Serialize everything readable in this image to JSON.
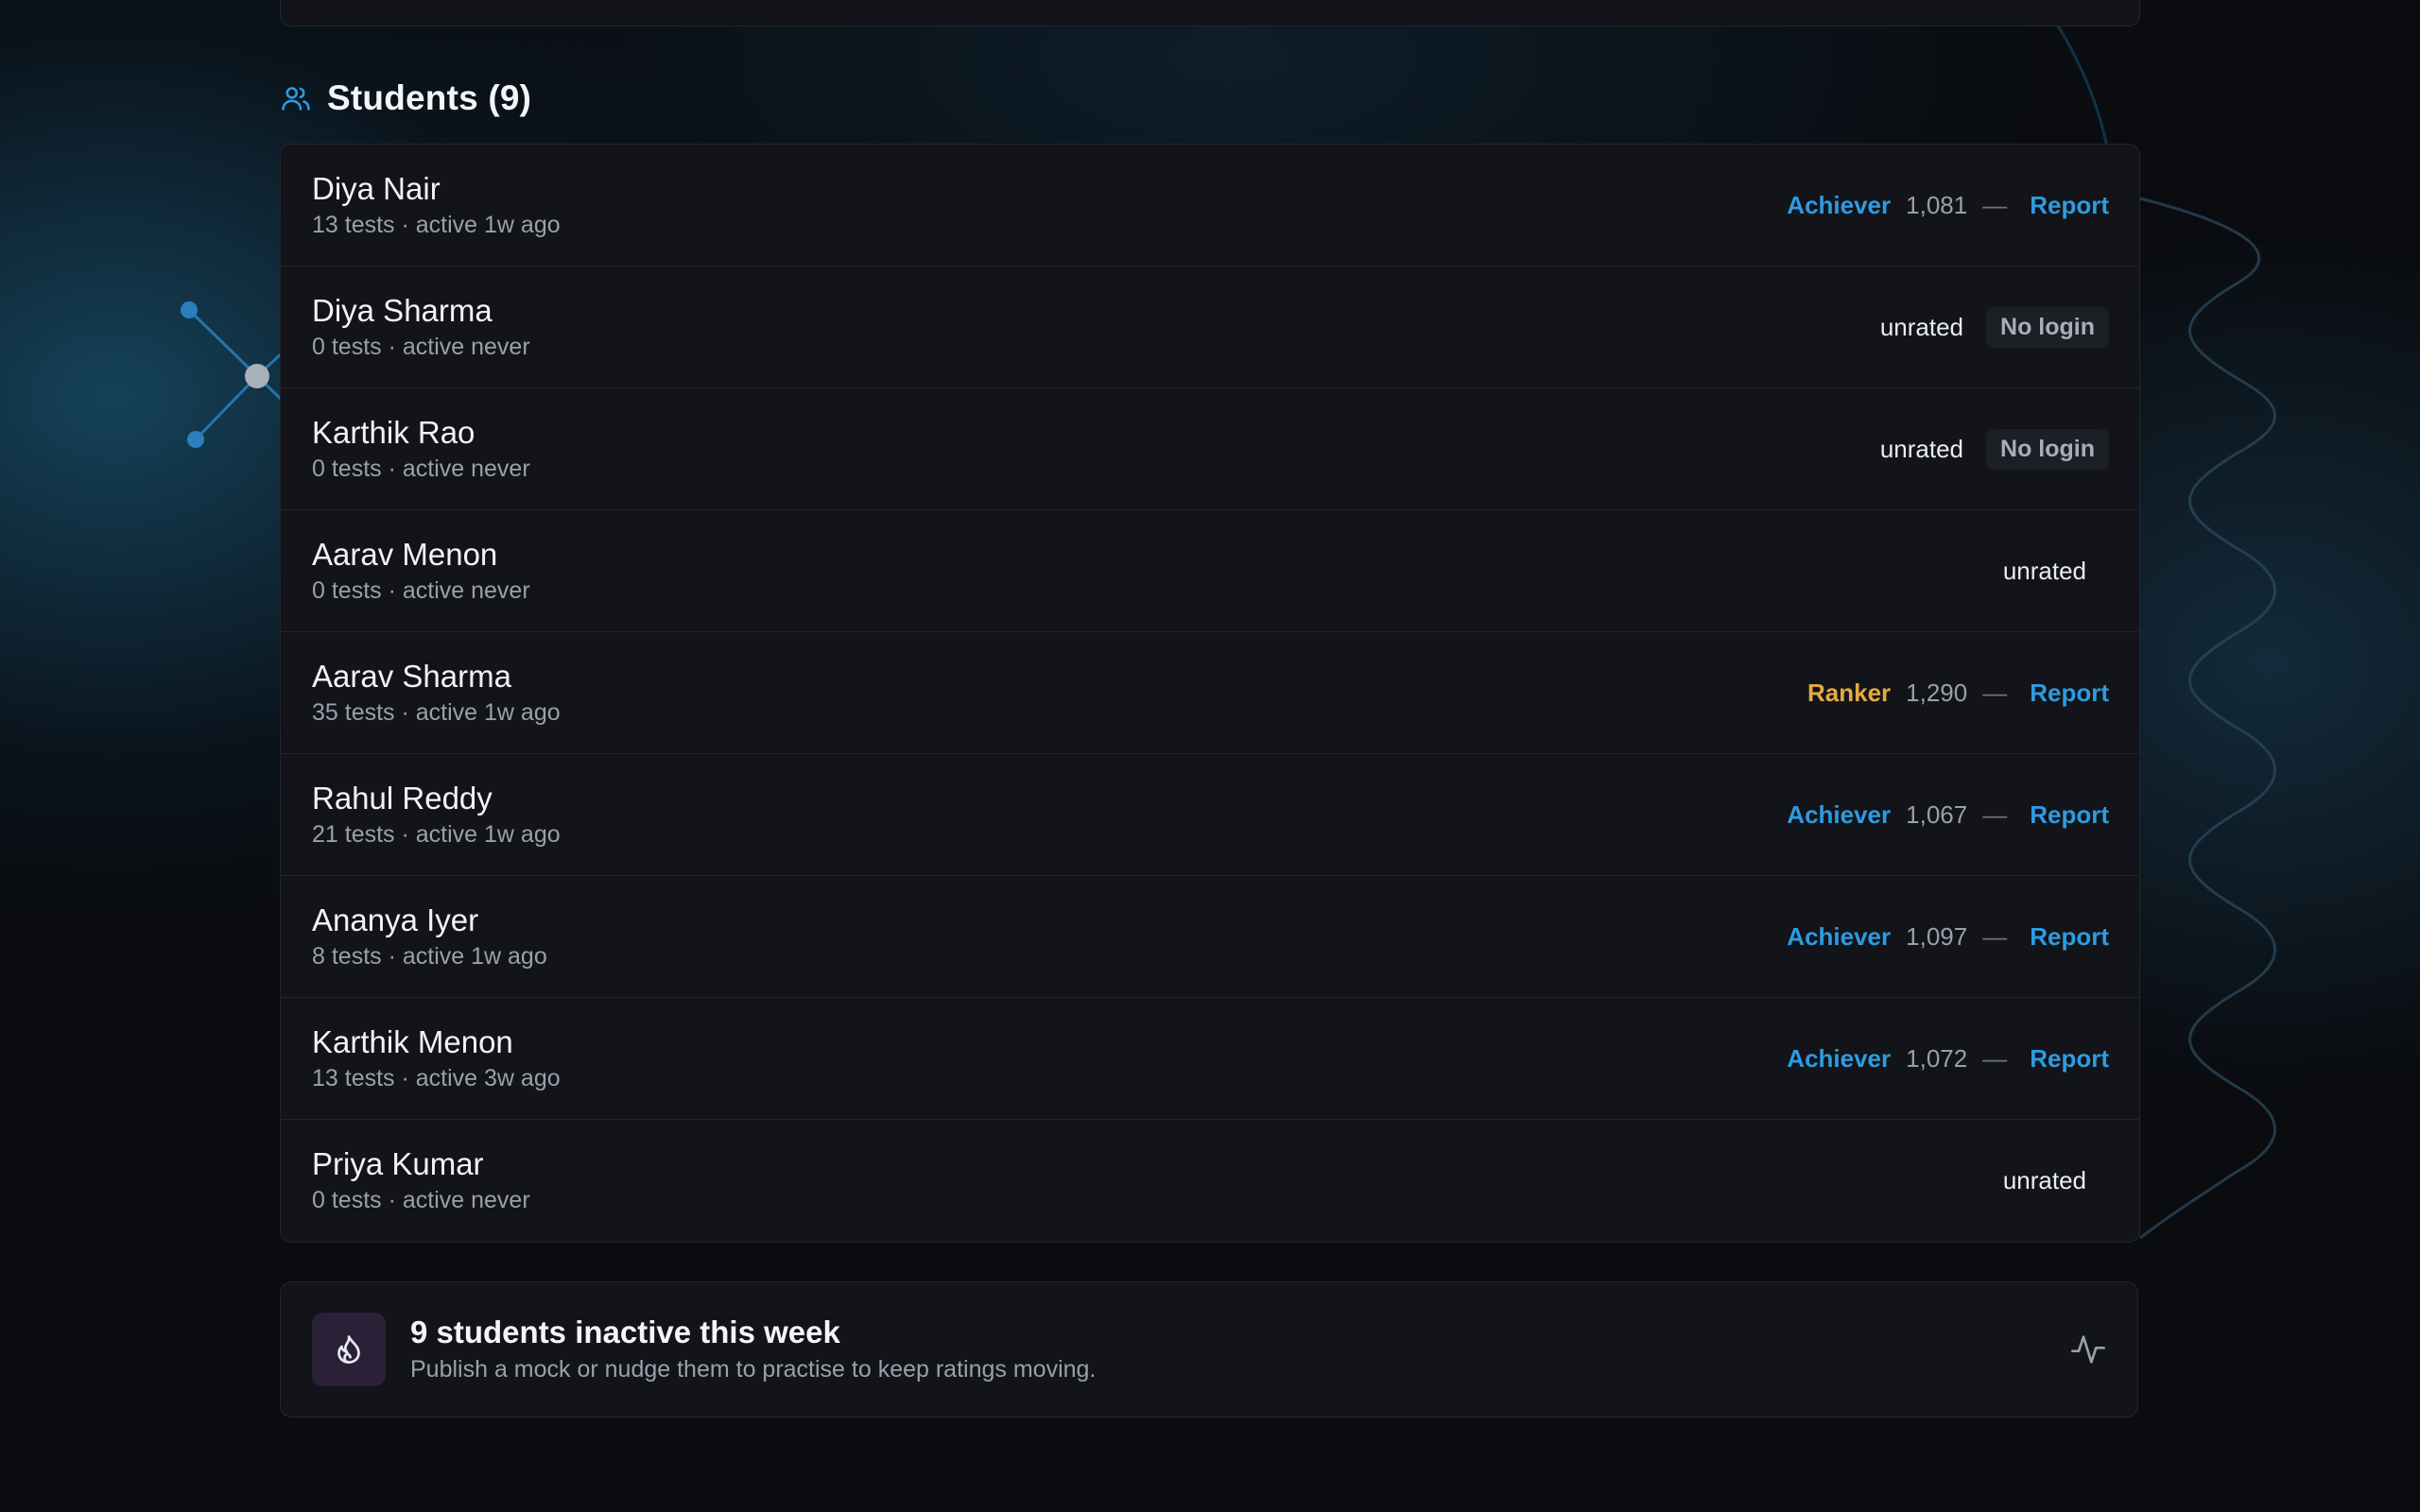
{
  "section": {
    "title": "Students (9)",
    "icon": "users-icon"
  },
  "students": [
    {
      "name": "Diya Nair",
      "meta": "13 tests · active 1w ago",
      "tier": "Achiever",
      "tier_kind": "achiever",
      "rating": "1,081",
      "dash": "—",
      "action": "Report"
    },
    {
      "name": "Diya Sharma",
      "meta": "0 tests · active never",
      "status": "unrated",
      "badge": "No login"
    },
    {
      "name": "Karthik Rao",
      "meta": "0 tests · active never",
      "status": "unrated",
      "badge": "No login"
    },
    {
      "name": "Aarav Menon",
      "meta": "0 tests · active never",
      "status": "unrated"
    },
    {
      "name": "Aarav Sharma",
      "meta": "35 tests · active 1w ago",
      "tier": "Ranker",
      "tier_kind": "ranker",
      "rating": "1,290",
      "dash": "—",
      "action": "Report"
    },
    {
      "name": "Rahul Reddy",
      "meta": "21 tests · active 1w ago",
      "tier": "Achiever",
      "tier_kind": "achiever",
      "rating": "1,067",
      "dash": "—",
      "action": "Report"
    },
    {
      "name": "Ananya Iyer",
      "meta": "8 tests · active 1w ago",
      "tier": "Achiever",
      "tier_kind": "achiever",
      "rating": "1,097",
      "dash": "—",
      "action": "Report"
    },
    {
      "name": "Karthik Menon",
      "meta": "13 tests · active 3w ago",
      "tier": "Achiever",
      "tier_kind": "achiever",
      "rating": "1,072",
      "dash": "—",
      "action": "Report"
    },
    {
      "name": "Priya Kumar",
      "meta": "0 tests · active never",
      "status": "unrated"
    }
  ],
  "banner": {
    "title": "9 students inactive this week",
    "subtitle": "Publish a mock or nudge them to practise to keep ratings moving.",
    "icon": "flame-icon",
    "action_icon": "activity-icon"
  },
  "colors": {
    "accent": "#2e9be0",
    "ranker": "#e6a93f",
    "background": "#0a0c10",
    "card": "#121419"
  }
}
